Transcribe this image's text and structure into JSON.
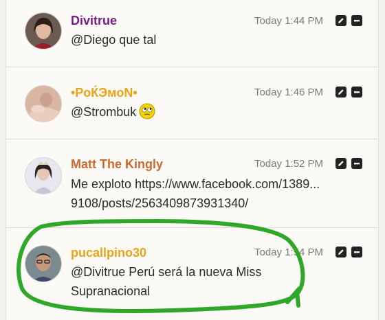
{
  "messages": [
    {
      "name": "Divitrue",
      "name_color": "#7a1b8c",
      "time": "Today 1:44 PM",
      "text": "@Diego que tal"
    },
    {
      "name": "•PoЌЭмoN•",
      "name_color": "#e8a318",
      "time": "Today 1:46 PM",
      "text": "@Strombuk"
    },
    {
      "name": "Matt The Kingly",
      "name_color": "#c96a2e",
      "time": "Today 1:52 PM",
      "text_prefix": "Me exploto ",
      "link_line1": "https://www.facebook.com/1389...",
      "link_line2": "9108/posts/2563409873931340/"
    },
    {
      "name": "pucallpino30",
      "name_color": "#e8a318",
      "time": "Today 1:54 PM",
      "text_line1": "@Divitrue Perú será la nueva Miss",
      "text_line2": "Supranacional"
    }
  ],
  "icons": {
    "edit": "pencil-icon",
    "delete": "minus-icon"
  },
  "highlight_color": "#2fa82a"
}
